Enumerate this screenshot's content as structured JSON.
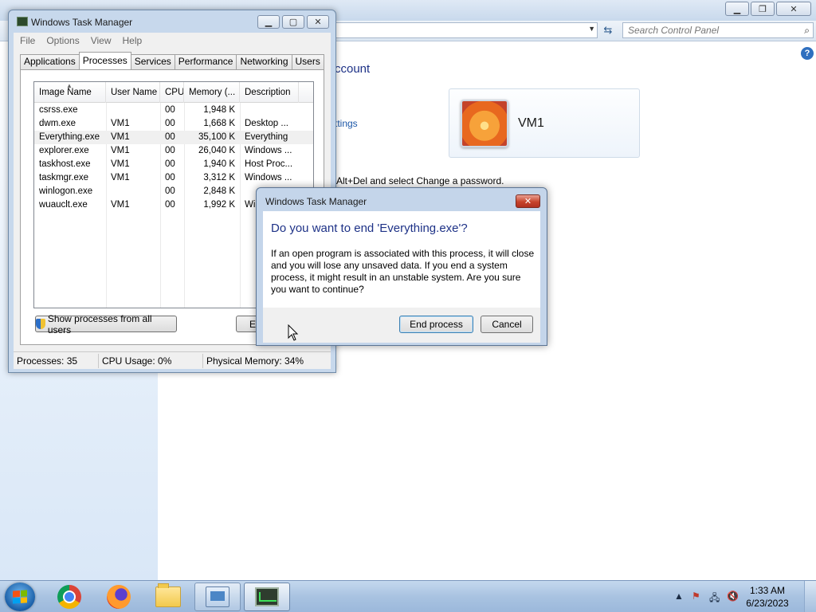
{
  "control_panel": {
    "search_placeholder": "Search Control Panel",
    "heading": "ccount",
    "link": "ttings",
    "user_name": "VM1",
    "body_text": "Alt+Del and select Change a password.",
    "help_glyph": "?"
  },
  "task_manager": {
    "title": "Windows Task Manager",
    "menu": [
      "File",
      "Options",
      "View",
      "Help"
    ],
    "tabs": [
      "Applications",
      "Processes",
      "Services",
      "Performance",
      "Networking",
      "Users"
    ],
    "active_tab": "Processes",
    "columns": [
      "Image Name",
      "User Name",
      "CPU",
      "Memory (...",
      "Description"
    ],
    "rows": [
      {
        "image": "csrss.exe",
        "user": "",
        "cpu": "00",
        "memory": "1,948 K",
        "desc": ""
      },
      {
        "image": "dwm.exe",
        "user": "VM1",
        "cpu": "00",
        "memory": "1,668 K",
        "desc": "Desktop ..."
      },
      {
        "image": "Everything.exe",
        "user": "VM1",
        "cpu": "00",
        "memory": "35,100 K",
        "desc": "Everything"
      },
      {
        "image": "explorer.exe",
        "user": "VM1",
        "cpu": "00",
        "memory": "26,040 K",
        "desc": "Windows ..."
      },
      {
        "image": "taskhost.exe",
        "user": "VM1",
        "cpu": "00",
        "memory": "1,940 K",
        "desc": "Host Proc..."
      },
      {
        "image": "taskmgr.exe",
        "user": "VM1",
        "cpu": "00",
        "memory": "3,312 K",
        "desc": "Windows ..."
      },
      {
        "image": "winlogon.exe",
        "user": "",
        "cpu": "00",
        "memory": "2,848 K",
        "desc": ""
      },
      {
        "image": "wuauclt.exe",
        "user": "VM1",
        "cpu": "00",
        "memory": "1,992 K",
        "desc": "Win"
      }
    ],
    "show_all_label": "Show processes from all users",
    "end_process_partial": "E",
    "status": {
      "processes": "Processes: 35",
      "cpu": "CPU Usage: 0%",
      "memory": "Physical Memory: 34%"
    }
  },
  "dialog": {
    "title": "Windows Task Manager",
    "heading": "Do you want to end 'Everything.exe'?",
    "lines": [
      "If an open program is associated with this process, it will close",
      "and you will lose any unsaved data. If you end a system",
      "process, it might result in an unstable system. Are you sure",
      "you want to continue?"
    ],
    "end_label": "End process",
    "cancel_label": "Cancel",
    "close_glyph": "✕"
  },
  "taskbar": {
    "apps": [
      "chrome-icon",
      "firefox-icon",
      "file-explorer-icon",
      "control-panel-icon",
      "task-manager-icon"
    ],
    "time": "1:33 AM",
    "date": "6/23/2023"
  }
}
